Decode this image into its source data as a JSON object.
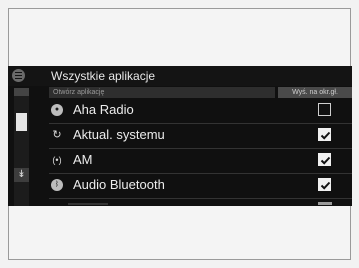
{
  "header": {
    "title": "Wszystkie aplikacje"
  },
  "subheader": {
    "placeholder_label": "Otwórz aplikację",
    "column_label": "Wyś. na okr.gł."
  },
  "apps": [
    {
      "label": "Aha Radio",
      "icon": "aha-icon",
      "checked": false
    },
    {
      "label": "Aktual. systemu",
      "icon": "refresh-icon",
      "checked": true
    },
    {
      "label": "AM",
      "icon": "antenna-icon",
      "checked": true
    },
    {
      "label": "Audio Bluetooth",
      "icon": "bluetooth-icon",
      "checked": true
    }
  ],
  "colors": {
    "screen_bg": "#101010",
    "text": "#ececec",
    "subbar": "#2e2e2e",
    "check_fill": "#f0f0f0"
  }
}
